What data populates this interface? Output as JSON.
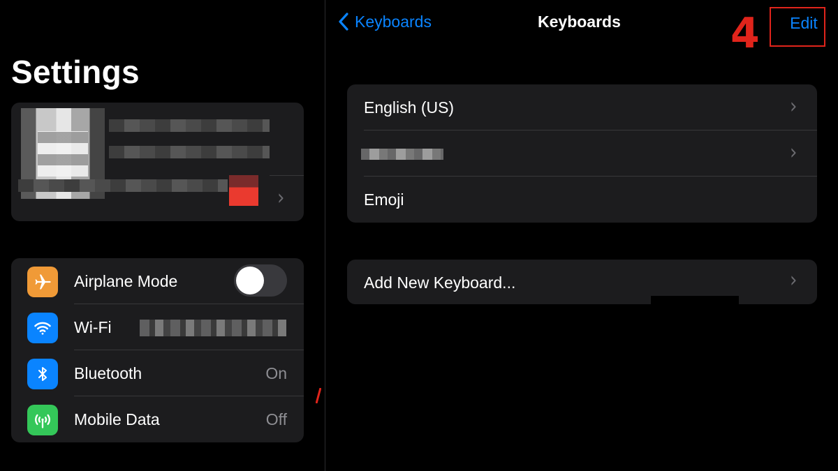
{
  "sidebar": {
    "title": "Settings",
    "items": [
      {
        "label": "Airplane Mode",
        "icon": "airplane-icon",
        "icon_color": "#f09a37",
        "control": "toggle",
        "toggle_on": false
      },
      {
        "label": "Wi-Fi",
        "icon": "wifi-icon",
        "icon_color": "#0a84ff",
        "value": ""
      },
      {
        "label": "Bluetooth",
        "icon": "bluetooth-icon",
        "icon_color": "#0a84ff",
        "value": "On"
      },
      {
        "label": "Mobile Data",
        "icon": "antenna-icon",
        "icon_color": "#34c759",
        "value": "Off"
      }
    ]
  },
  "detail": {
    "back_label": "Keyboards",
    "title": "Keyboards",
    "edit_label": "Edit",
    "step_number": "4",
    "keyboards": [
      {
        "label": "English (US)",
        "chevron": true
      },
      {
        "label": "",
        "chevron": true,
        "redacted": true
      },
      {
        "label": "Emoji",
        "chevron": false
      }
    ],
    "add_label": "Add New Keyboard..."
  },
  "colors": {
    "accent": "#0a84ff",
    "annotation_red": "#e0241b",
    "group_background": "#1c1c1e",
    "separator": "#38383a"
  }
}
